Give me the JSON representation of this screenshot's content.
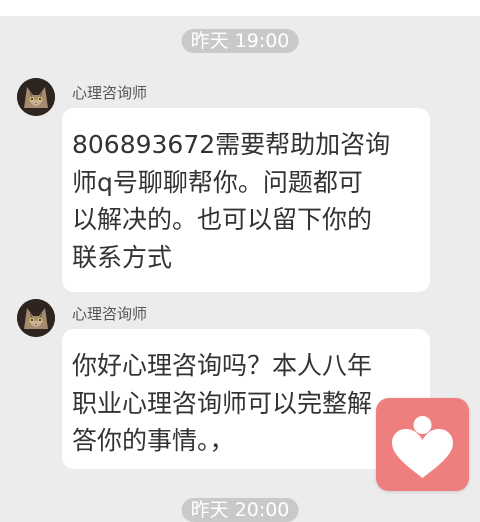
{
  "header_time": "昨天 19:00",
  "messages": [
    {
      "sender": "心理咨询师",
      "lines": [
        "806893672需要帮助加咨询",
        "师q号聊聊帮你。问题都可",
        "以解决的。也可以留下你的",
        "联系方式"
      ]
    },
    {
      "sender": "心理咨询师",
      "lines": [
        "你好心理咨询吗？本人八年",
        "职业心理咨询师可以完整解",
        "答你的事情。，"
      ]
    }
  ],
  "footer_time": "昨天 20:00",
  "colors": {
    "background": "#ececec",
    "bubble": "#ffffff",
    "time_pill": "#c9c9c9",
    "floating_button": "#ef7f7e"
  },
  "icons": {
    "avatar": "cat-avatar",
    "floating_button": "heart-person-icon"
  }
}
